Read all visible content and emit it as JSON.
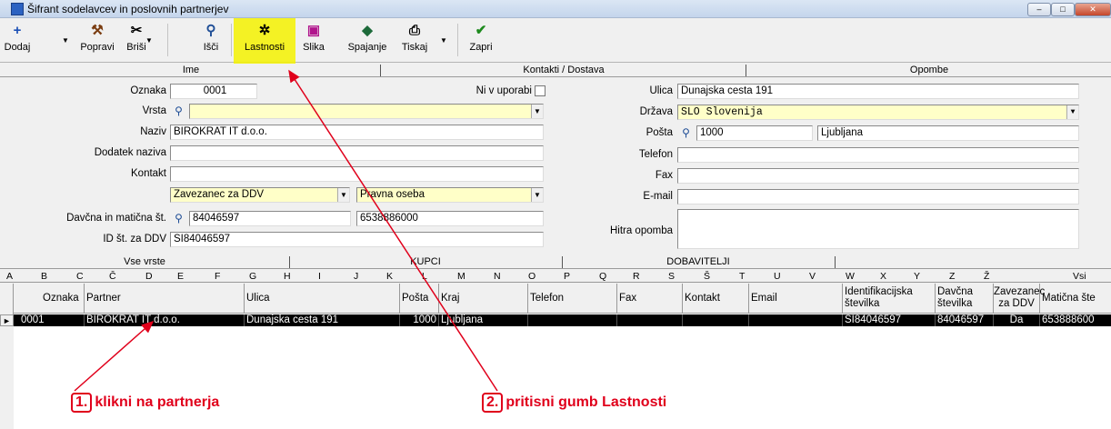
{
  "window": {
    "title": "Šifrant sodelavcev in poslovnih partnerjev"
  },
  "toolbar": {
    "dodaj": "Dodaj",
    "popravi": "Popravi",
    "brisi": "Briši",
    "isci": "Išči",
    "lastnosti": "Lastnosti",
    "slika": "Slika",
    "spajanje": "Spajanje",
    "tiskaj": "Tiskaj",
    "zapri": "Zapri"
  },
  "tabs": {
    "ime": "Ime",
    "kontakti": "Kontakti / Dostava",
    "opombe": "Opombe"
  },
  "form": {
    "oznaka_label": "Oznaka",
    "oznaka": "0001",
    "ni_v_uporabi": "Ni v uporabi",
    "vrsta_label": "Vrsta",
    "vrsta": "",
    "naziv_label": "Naziv",
    "naziv": "BIROKRAT IT d.o.o.",
    "dodatek_label": "Dodatek naziva",
    "dodatek": "",
    "kontakt_label": "Kontakt",
    "kontakt": "",
    "ddv": "Zavezanec za DDV",
    "oseba": "Pravna oseba",
    "davcna_label": "Davčna in matična št.",
    "davcna": "84046597",
    "maticna": "6538886000",
    "idddv_label": "ID št. za DDV",
    "idddv": "SI84046597",
    "ulica_label": "Ulica",
    "ulica": "Dunajska cesta 191",
    "drzava_label": "Država",
    "drzava": "SLO  Slovenija",
    "posta_label": "Pošta",
    "posta": "1000",
    "kraj": "Ljubljana",
    "telefon_label": "Telefon",
    "telefon": "",
    "fax_label": "Fax",
    "fax": "",
    "email_label": "E-mail",
    "email": "",
    "hitra_label": "Hitra opomba",
    "hitra": ""
  },
  "filter_tabs": {
    "vse": "Vse vrste",
    "kupci": "KUPCI",
    "dobavitelji": "DOBAVITELJI"
  },
  "letters": [
    "A",
    "B",
    "C",
    "Č",
    "D",
    "E",
    "F",
    "G",
    "H",
    "I",
    "J",
    "K",
    "L",
    "M",
    "N",
    "O",
    "P",
    "Q",
    "R",
    "S",
    "Š",
    "T",
    "U",
    "V",
    "W",
    "X",
    "Y",
    "Z",
    "Ž",
    "Vsi"
  ],
  "grid": {
    "headers": {
      "oznaka": "Oznaka",
      "partner": "Partner",
      "ulica": "Ulica",
      "posta": "Pošta",
      "kraj": "Kraj",
      "telefon": "Telefon",
      "fax": "Fax",
      "kontakt": "Kontakt",
      "email": "Email",
      "idst": "Identifikacijska številka",
      "davcna": "Davčna številka",
      "zavezanec": "Zavezanec za DDV",
      "maticna": "Matična šte"
    },
    "row": {
      "oznaka": "0001",
      "partner": "BIROKRAT IT d.o.o.",
      "ulica": "Dunajska cesta 191",
      "posta": "1000",
      "kraj": "Ljubljana",
      "telefon": "",
      "fax": "",
      "kontakt": "",
      "email": "",
      "idst": "SI84046597",
      "davcna": "84046597",
      "zavezanec": "Da",
      "maticna": "653888600"
    }
  },
  "annotations": {
    "a1_num": "1.",
    "a1_text": "klikni na partnerja",
    "a2_num": "2.",
    "a2_text": "pritisni gumb Lastnosti"
  },
  "colors": {
    "highlight": "#f5f200",
    "annotation": "#e0001b",
    "required_field": "#ffffc8"
  }
}
